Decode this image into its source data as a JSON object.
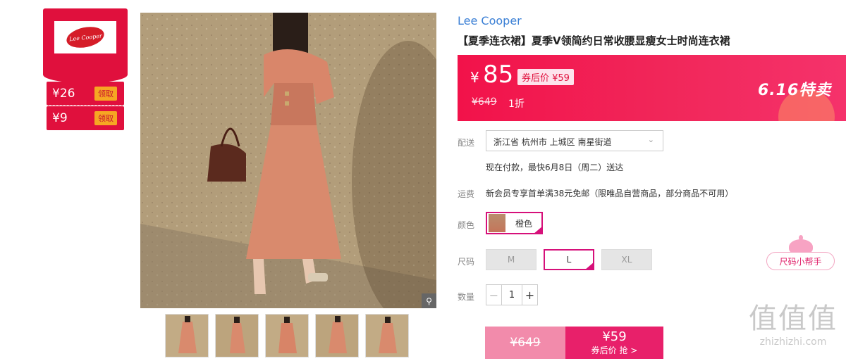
{
  "brand_panel": {
    "logo_text": "Lee Cooper",
    "coupons": [
      {
        "amount": "¥26",
        "action": "领取"
      },
      {
        "amount": "¥9",
        "action": "领取"
      }
    ]
  },
  "gallery": {
    "zoom_icon": "magnifier-icon",
    "thumbnail_count": 5
  },
  "product": {
    "brand": "Lee Cooper",
    "title": "【夏季连衣裙】夏季V领简约日常收腰显瘦女士时尚连衣裙"
  },
  "price": {
    "currency": "¥",
    "current": "85",
    "after_coupon": "券后价 ¥59",
    "original": "¥649",
    "discount": "1折",
    "promo": "6.16特卖"
  },
  "delivery": {
    "label": "配送",
    "address": "浙江省 杭州市 上城区 南星街道",
    "eta": "现在付款，最快6月8日（周二）送达"
  },
  "shipping": {
    "label": "运费",
    "text": "新会员专享首单满38元免邮（限唯品自营商品，部分商品不可用）"
  },
  "color": {
    "label": "颜色",
    "option": "橙色"
  },
  "size": {
    "label": "尺码",
    "options": [
      "M",
      "L",
      "XL"
    ],
    "selected": "L",
    "helper": "尺码小帮手"
  },
  "quantity": {
    "label": "数量",
    "value": "1",
    "minus": "−",
    "plus": "+"
  },
  "buy_button": {
    "original": "¥649",
    "price": "¥59",
    "action": "券后价 抢 >"
  },
  "watermark": {
    "big": "值值值",
    "small": "zhizhizhi.com"
  },
  "colors": {
    "primary_red": "#e0103d",
    "accent_pink": "#d6107a",
    "link_blue": "#3a7fd5"
  }
}
